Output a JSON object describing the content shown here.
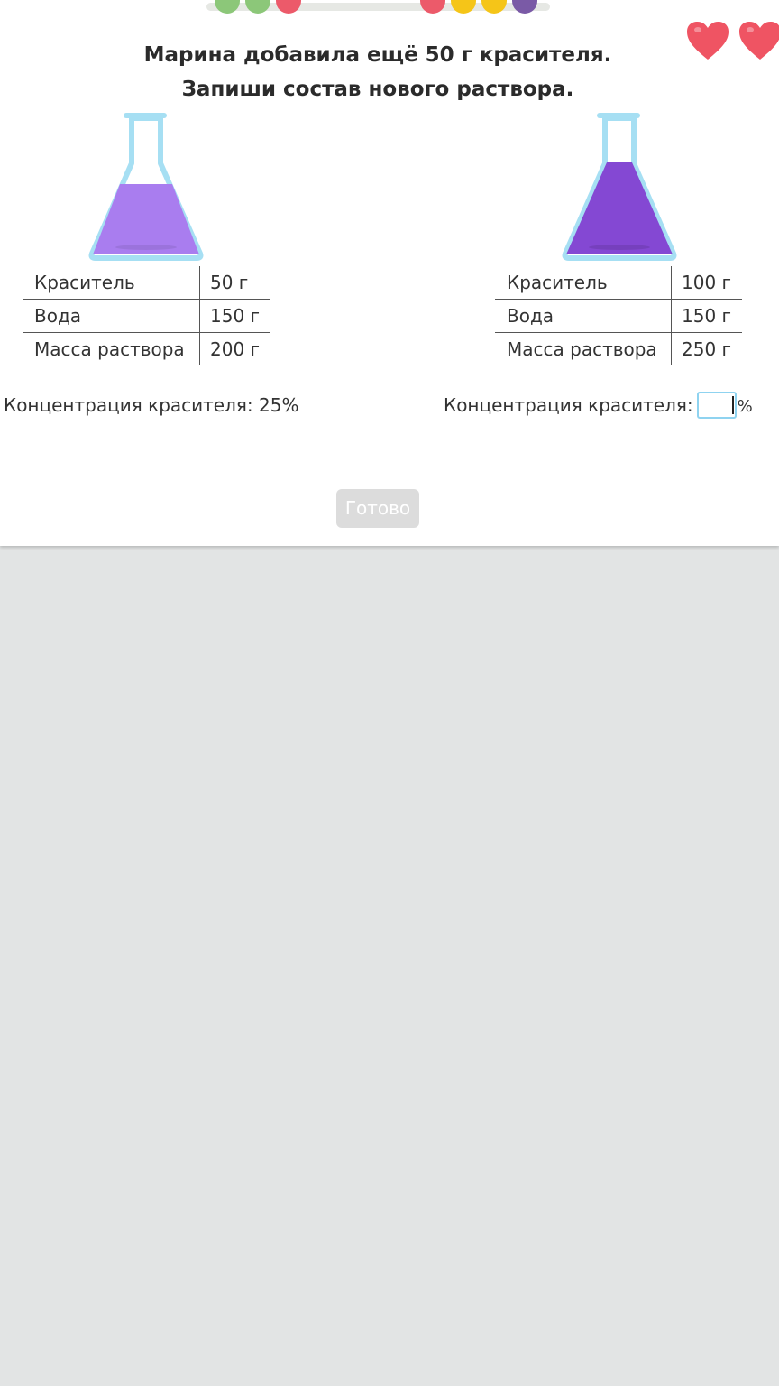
{
  "progress": {
    "dots": [
      {
        "color": "#8cc779"
      },
      {
        "color": "#8cc779"
      },
      {
        "color": "#ec5a6a"
      },
      {
        "color": "#ec5a6a"
      },
      {
        "color": "#f5c518"
      },
      {
        "color": "#f5c518"
      },
      {
        "color": "#7a5aa6"
      }
    ]
  },
  "lives": {
    "count": 2,
    "icon": "heart-icon",
    "color": "#ef5463"
  },
  "question": {
    "line1": "Марина добавила ещё 50 г красителя.",
    "line2": "Запиши состав нового раствора."
  },
  "left": {
    "flask_icon": "flask-icon",
    "liquid_color": "#a97def",
    "table": [
      {
        "label": "Краситель",
        "value": "50 г"
      },
      {
        "label": "Вода",
        "value": "150 г"
      },
      {
        "label": "Масса раствора",
        "value": "200 г"
      }
    ],
    "concentration_label": "Концентрация красителя:",
    "concentration_value": "25%"
  },
  "right": {
    "flask_icon": "flask-icon",
    "liquid_color": "#8448d3",
    "table": [
      {
        "label": "Краситель",
        "value": "100 г"
      },
      {
        "label": "Вода",
        "value": "150 г"
      },
      {
        "label": "Масса раствора",
        "value": "250 г"
      }
    ],
    "concentration_label": "Концентрация красителя:",
    "input_value": "",
    "unit": "%"
  },
  "done_button": {
    "label": "Готово",
    "enabled": false
  },
  "colors": {
    "background": "#e2e4e4",
    "card": "#ffffff",
    "flask_glass": "#a6dff3"
  }
}
